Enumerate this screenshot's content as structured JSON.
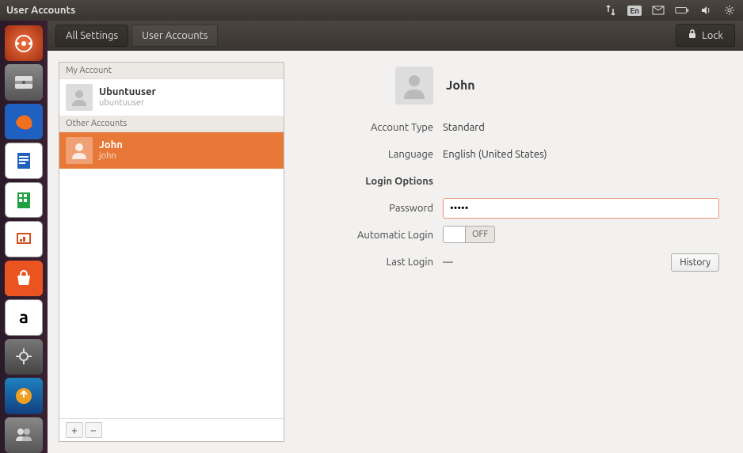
{
  "window_title": "User Accounts",
  "tray": {
    "lang": "En"
  },
  "toolbar": {
    "all_settings": "All Settings",
    "user_accounts": "User Accounts",
    "lock": "Lock"
  },
  "sidebar": {
    "my_account_header": "My Account",
    "other_accounts_header": "Other Accounts",
    "my_account": {
      "name": "Ubuntuuser",
      "sub": "ubuntuuser"
    },
    "other": {
      "name": "John",
      "sub": "john"
    },
    "add": "+",
    "remove": "−"
  },
  "detail": {
    "name": "John",
    "labels": {
      "account_type": "Account Type",
      "language": "Language",
      "login_options": "Login Options",
      "password": "Password",
      "auto_login": "Automatic Login",
      "last_login": "Last Login"
    },
    "values": {
      "account_type": "Standard",
      "language": "English (United States)",
      "password": "•••••",
      "auto_login": "OFF",
      "last_login": "—"
    },
    "history": "History"
  }
}
